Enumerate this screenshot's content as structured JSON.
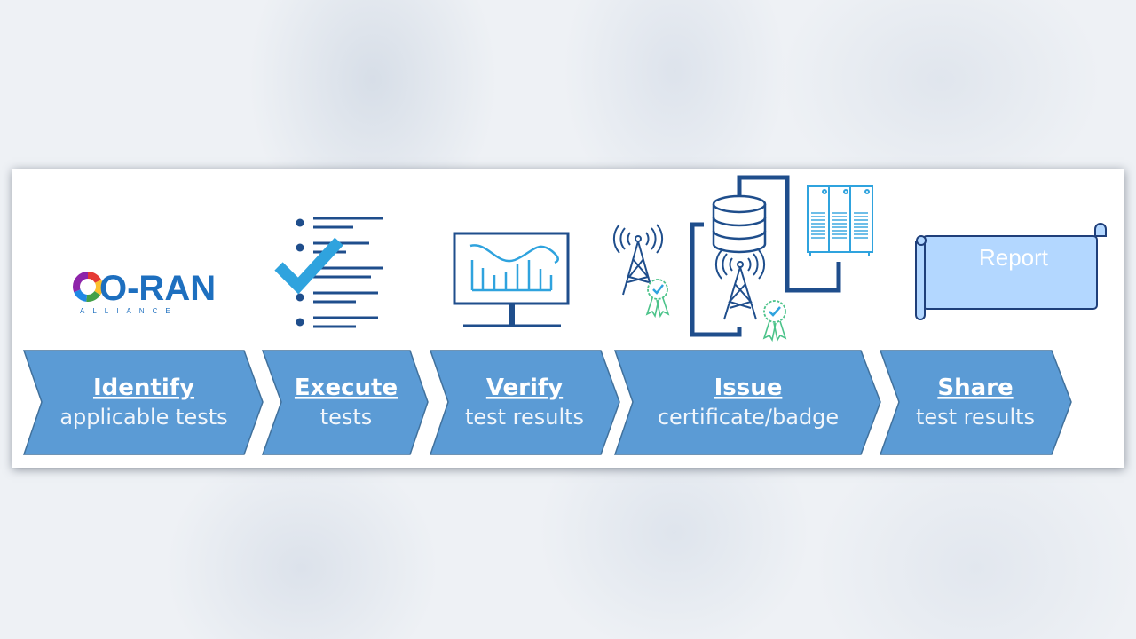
{
  "diagram": {
    "logo": {
      "name": "O-RAN",
      "subtitle": "ALLIANCE"
    },
    "report_label": "Report",
    "colors": {
      "chevron_fill": "#5b9bd5",
      "chevron_stroke": "#41719c",
      "icon_dark": "#1f4e8c",
      "icon_light": "#2fa3de",
      "badge_green": "#4cc38a",
      "report_fill": "#b3d7ff",
      "report_stroke": "#1f3f7a"
    },
    "steps": [
      {
        "title": "Identify",
        "subtitle": "applicable tests",
        "icon": "oran-logo"
      },
      {
        "title": "Execute",
        "subtitle": "tests",
        "icon": "checklist-icon"
      },
      {
        "title": "Verify",
        "subtitle": "test results",
        "icon": "monitor-chart-icon"
      },
      {
        "title": "Issue",
        "subtitle": "certificate/badge",
        "icon": "certified-towers-icon"
      },
      {
        "title": "Share",
        "subtitle": "test results",
        "icon": "report-scroll-icon"
      }
    ]
  }
}
